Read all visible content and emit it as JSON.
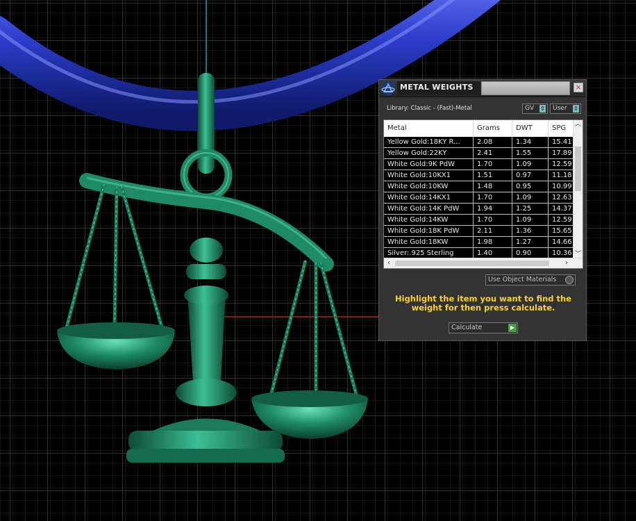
{
  "panel": {
    "title": "METAL WEIGHTS",
    "close_label": "×",
    "library_label": "Library: Classic - (Fast)-Metal",
    "gv_dropdown": "GV",
    "user_dropdown": "User",
    "columns": [
      "Metal",
      "Grams",
      "DWT",
      "SPG"
    ],
    "rows": [
      [
        "Yellow Gold:18KY R...",
        "2.08",
        "1.34",
        "15.41"
      ],
      [
        "Yellow Gold:22KY",
        "2.41",
        "1.55",
        "17.89"
      ],
      [
        "White Gold:9K PdW",
        "1.70",
        "1.09",
        "12.59"
      ],
      [
        "White Gold:10KX1",
        "1.51",
        "0.97",
        "11.18"
      ],
      [
        "White Gold:10KW",
        "1.48",
        "0.95",
        "10.99"
      ],
      [
        "White Gold:14KX1",
        "1.70",
        "1.09",
        "12.63"
      ],
      [
        "White Gold:14K PdW",
        "1.94",
        "1.25",
        "14.37"
      ],
      [
        "White Gold:14KW",
        "1.70",
        "1.09",
        "12.59"
      ],
      [
        "White Gold:18K PdW",
        "2.11",
        "1.36",
        "15.65"
      ],
      [
        "White Gold:18KW",
        "1.98",
        "1.27",
        "14.66"
      ],
      [
        "Silver:.925 Sterling",
        "1.40",
        "0.90",
        "10.36"
      ]
    ],
    "use_object_materials": "Use Object Materials",
    "hint": "Highlight the item you want to find the weight for then press calculate.",
    "calculate_label": "Calculate"
  },
  "colors": {
    "hint_text": "#f7d23a",
    "pendant": "#1f8a66",
    "chain": "#2436b8",
    "grid_line": "#3a3a3a"
  },
  "icons": {
    "app": "app-logo-icon",
    "close": "close-icon",
    "dropdown": "dropdown-arrow-icon",
    "scroll_up": "scroll-up-icon",
    "scroll_down": "scroll-down-icon",
    "scroll_left": "scroll-left-icon",
    "scroll_right": "scroll-right-icon",
    "go": "play-icon"
  }
}
